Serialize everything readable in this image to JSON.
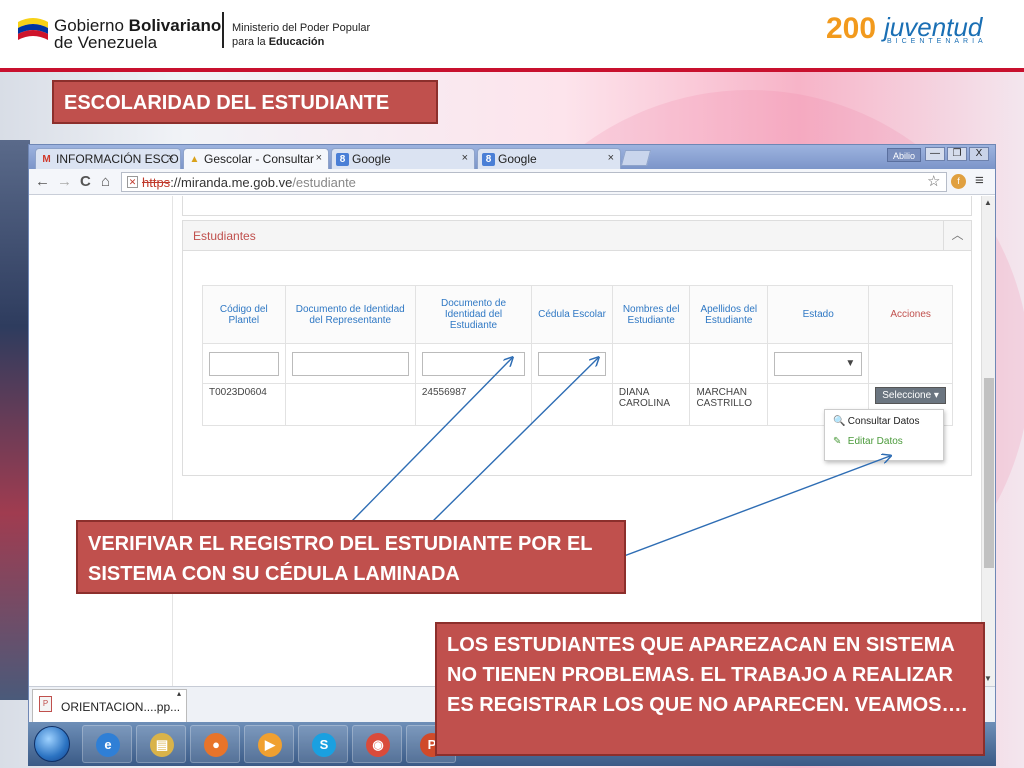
{
  "header": {
    "gov_line1_a": "Gobierno ",
    "gov_line1_b": "Bolivariano",
    "gov_line2": "de Venezuela",
    "ministry_line1": "Ministerio  del Poder Popular",
    "ministry_line2_a": "para la ",
    "ministry_line2_b": "Educación",
    "logo_200": "200",
    "logo_word": "juventud",
    "logo_sub": "BICENTENARIA"
  },
  "slide_title": "ESCOLARIDAD DEL ESTUDIANTE",
  "browser": {
    "tabs": [
      {
        "icon": "M",
        "label": "INFORMACIÓN ESCO",
        "close": "×"
      },
      {
        "icon": "▲",
        "label": "Gescolar - Consultar",
        "close": "×"
      },
      {
        "icon": "8",
        "label": "Google",
        "close": "×"
      },
      {
        "icon": "8",
        "label": "Google",
        "close": "×"
      }
    ],
    "window_user": "Abilio",
    "window_buttons": [
      "—",
      "❐",
      "X"
    ],
    "nav": {
      "back": "←",
      "forward": "→",
      "reload": "C",
      "home": "⌂"
    },
    "url_scheme": "https",
    "url_host": "://miranda.me.gob.ve",
    "url_path": "/estudiante",
    "lock_glyph": "✕",
    "star_glyph": "☆",
    "ext_glyph": "f",
    "menu_glyph": "≡"
  },
  "page": {
    "panel_title": "Estudiantes",
    "collapse_glyph": "︿",
    "columns": [
      "Código del Plantel",
      "Documento de Identidad del Representante",
      "Documento de Identidad del Estudiante",
      "Cédula Escolar",
      "Nombres del Estudiante",
      "Apellidos del Estudiante",
      "Estado",
      "Acciones"
    ],
    "select_arrow": "▼",
    "row": {
      "codigo": "T0023D0604",
      "doc_representante": "",
      "doc_estudiante": "24556987",
      "cedula_escolar": "",
      "nombres": "DIANA CAROLINA",
      "apellidos": "MARCHAN CASTRILLO",
      "estado": "",
      "action_button": "Seleccione ▾"
    },
    "dropdown": {
      "consult_icon": "🔍",
      "consult": "Consultar Datos",
      "edit_icon": "✎",
      "edit": "Editar Datos"
    }
  },
  "scrollbar": {
    "up": "▲",
    "down": "▼"
  },
  "download": {
    "file_icon": "P",
    "file": "ORIENTACION....pp...",
    "arrow": "▴"
  },
  "taskbar": {
    "apps": [
      {
        "glyph": "e",
        "color": "#2f7fd6"
      },
      {
        "glyph": "▤",
        "color": "#d9b34a"
      },
      {
        "glyph": "●",
        "color": "#e8742a"
      },
      {
        "glyph": "▶",
        "color": "#f0a030"
      },
      {
        "glyph": "S",
        "color": "#1aa0e0"
      },
      {
        "glyph": "◉",
        "color": "#d94b3b"
      },
      {
        "glyph": "P",
        "color": "#d04a2a"
      }
    ]
  },
  "callouts": {
    "first": "VERIFIVAR EL REGISTRO DEL ESTUDIANTE POR EL SISTEMA CON SU CÉDULA LAMINADA",
    "second": "LOS ESTUDIANTES QUE APAREZACAN EN SISTEMA NO TIENEN PROBLEMAS. EL TRABAJO A REALIZAR ES REGISTRAR LOS QUE NO APARECEN. VEAMOS…."
  },
  "colors": {
    "accent_red": "#c0504d",
    "link_blue": "#2f78c4",
    "arrow_blue": "#2e6db4"
  }
}
